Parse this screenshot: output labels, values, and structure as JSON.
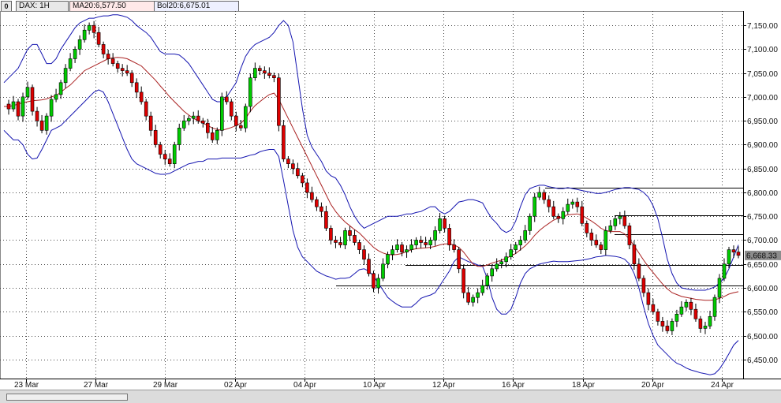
{
  "toolbar": {
    "symbol": "DAX: 1H",
    "ma_label": "MA20:6,577.50",
    "bol_label": "Bol20:6,675.01"
  },
  "colors": {
    "up": "#00cc00",
    "down": "#dd0000",
    "ma": "#aa2222",
    "bands": "#1515b0",
    "grid": "#444444",
    "hlines": "#000000"
  },
  "chart_data": {
    "type": "candlestick",
    "title": "DAX: 1H",
    "ylim": [
      6410,
      7180
    ],
    "y_ticks": [
      "7,150.00",
      "7,100.00",
      "7,050.00",
      "7,000.00",
      "6,950.00",
      "6,900.00",
      "6,850.00",
      "6,800.00",
      "6,750.00",
      "6,700.00",
      "6,650.00",
      "6,600.00",
      "6,550.00",
      "6,500.00",
      "6,450.00"
    ],
    "y_tick_values": [
      7150,
      7100,
      7050,
      7000,
      6950,
      6900,
      6850,
      6800,
      6750,
      6700,
      6650,
      6600,
      6550,
      6500,
      6450
    ],
    "x_labels": [
      "23 Mar",
      "27 Mar",
      "29 Mar",
      "02 Apr",
      "04 Apr",
      "10 Apr",
      "12 Apr",
      "16 Apr",
      "18 Apr",
      "20 Apr",
      "24 Apr"
    ],
    "last_price": "6,668.33",
    "grid": true,
    "horizontal_lines": [
      {
        "from": "18 Apr",
        "y": 6810
      },
      {
        "from": "20 Apr",
        "y": 6752
      },
      {
        "from": "20 Apr",
        "y": 6713
      },
      {
        "from": "12 Apr",
        "y": 6648
      },
      {
        "from": "10 Apr",
        "y": 6605
      }
    ],
    "close_path": [
      6985,
      6975,
      6990,
      6960,
      7000,
      7020,
      6970,
      6950,
      6930,
      6960,
      6995,
      7005,
      7030,
      7060,
      7080,
      7100,
      7120,
      7140,
      7150,
      7135,
      7110,
      7090,
      7080,
      7070,
      7060,
      7055,
      7050,
      7030,
      7010,
      6990,
      6960,
      6930,
      6900,
      6880,
      6870,
      6860,
      6900,
      6935,
      6950,
      6955,
      6960,
      6950,
      6945,
      6925,
      6910,
      6930,
      7000,
      6990,
      6960,
      6940,
      6935,
      6980,
      7040,
      7060,
      7055,
      7050,
      7045,
      7040,
      6940,
      6870,
      6860,
      6850,
      6835,
      6820,
      6800,
      6785,
      6770,
      6760,
      6725,
      6700,
      6695,
      6690,
      6720,
      6710,
      6695,
      6680,
      6660,
      6630,
      6600,
      6620,
      6650,
      6670,
      6680,
      6690,
      6675,
      6680,
      6690,
      6700,
      6695,
      6690,
      6700,
      6720,
      6745,
      6725,
      6690,
      6680,
      6640,
      6590,
      6570,
      6580,
      6590,
      6605,
      6625,
      6640,
      6650,
      6655,
      6665,
      6680,
      6690,
      6700,
      6720,
      6750,
      6790,
      6800,
      6785,
      6770,
      6750,
      6745,
      6760,
      6775,
      6780,
      6770,
      6735,
      6715,
      6700,
      6690,
      6680,
      6720,
      6730,
      6745,
      6750,
      6730,
      6690,
      6650,
      6620,
      6590,
      6565,
      6550,
      6530,
      6520,
      6510,
      6530,
      6545,
      6560,
      6570,
      6555,
      6535,
      6515,
      6520,
      6540,
      6580,
      6620,
      6650,
      6680,
      6675,
      6668
    ],
    "ma20": [
      6980,
      6980,
      6982,
      6985,
      6988,
      6990,
      6992,
      6993,
      6994,
      6996,
      7000,
      7003,
      7010,
      7018,
      7025,
      7035,
      7045,
      7055,
      7060,
      7065,
      7070,
      7075,
      7080,
      7082,
      7083,
      7082,
      7080,
      7075,
      7070,
      7065,
      7055,
      7045,
      7035,
      7023,
      7012,
      7000,
      6990,
      6980,
      6970,
      6962,
      6955,
      6950,
      6945,
      6940,
      6935,
      6932,
      6930,
      6933,
      6936,
      6940,
      6945,
      6955,
      6970,
      6982,
      6990,
      6998,
      7005,
      7008,
      6995,
      6975,
      6955,
      6935,
      6915,
      6895,
      6875,
      6855,
      6835,
      6815,
      6795,
      6775,
      6760,
      6748,
      6738,
      6730,
      6722,
      6715,
      6705,
      6695,
      6685,
      6678,
      6673,
      6670,
      6669,
      6670,
      6672,
      6676,
      6680,
      6682,
      6683,
      6684,
      6685,
      6687,
      6690,
      6692,
      6692,
      6690,
      6685,
      6675,
      6662,
      6650,
      6645,
      6645,
      6648,
      6652,
      6655,
      6658,
      6662,
      6667,
      6672,
      6680,
      6688,
      6698,
      6710,
      6720,
      6728,
      6735,
      6742,
      6746,
      6750,
      6753,
      6754,
      6755,
      6752,
      6746,
      6740,
      6733,
      6725,
      6720,
      6718,
      6718,
      6718,
      6713,
      6702,
      6688,
      6673,
      6658,
      6644,
      6632,
      6620,
      6608,
      6598,
      6590,
      6586,
      6582,
      6580,
      6578,
      6576,
      6575,
      6574,
      6574,
      6575,
      6578,
      6582,
      6587,
      6590,
      6592
    ],
    "upper_band": [
      7030,
      7040,
      7050,
      7060,
      7080,
      7100,
      7110,
      7110,
      7090,
      7070,
      7070,
      7080,
      7100,
      7115,
      7130,
      7145,
      7155,
      7160,
      7165,
      7165,
      7168,
      7170,
      7170,
      7172,
      7172,
      7170,
      7167,
      7160,
      7150,
      7142,
      7135,
      7125,
      7110,
      7095,
      7090,
      7090,
      7090,
      7088,
      7080,
      7070,
      7055,
      7040,
      7025,
      7010,
      6995,
      6990,
      6990,
      7000,
      7015,
      7030,
      7060,
      7085,
      7100,
      7110,
      7115,
      7120,
      7125,
      7135,
      7150,
      7160,
      7150,
      7115,
      7045,
      6975,
      6920,
      6895,
      6880,
      6865,
      6845,
      6835,
      6830,
      6815,
      6795,
      6770,
      6750,
      6735,
      6725,
      6730,
      6735,
      6740,
      6745,
      6750,
      6750,
      6750,
      6752,
      6755,
      6755,
      6758,
      6760,
      6765,
      6770,
      6770,
      6760,
      6755,
      6760,
      6770,
      6780,
      6782,
      6785,
      6785,
      6782,
      6778,
      6760,
      6745,
      6735,
      6722,
      6716,
      6721,
      6740,
      6770,
      6795,
      6808,
      6812,
      6815,
      6815,
      6812,
      6810,
      6808,
      6808,
      6810,
      6808,
      6806,
      6804,
      6802,
      6800,
      6798,
      6798,
      6800,
      6803,
      6806,
      6808,
      6810,
      6810,
      6808,
      6806,
      6800,
      6790,
      6772,
      6745,
      6705,
      6660,
      6630,
      6610,
      6600,
      6598,
      6596,
      6595,
      6595,
      6595,
      6598,
      6602,
      6610,
      6620,
      6640,
      6665,
      6690
    ],
    "lower_band": [
      6930,
      6920,
      6910,
      6910,
      6900,
      6880,
      6870,
      6872,
      6890,
      6910,
      6930,
      6935,
      6940,
      6950,
      6960,
      6970,
      6980,
      6990,
      7000,
      7010,
      7015,
      7010,
      6990,
      6965,
      6940,
      6915,
      6890,
      6870,
      6860,
      6855,
      6850,
      6845,
      6840,
      6838,
      6838,
      6840,
      6845,
      6850,
      6855,
      6860,
      6862,
      6865,
      6865,
      6870,
      6870,
      6870,
      6872,
      6872,
      6872,
      6872,
      6872,
      6875,
      6878,
      6880,
      6885,
      6888,
      6890,
      6890,
      6875,
      6825,
      6772,
      6720,
      6685,
      6665,
      6655,
      6645,
      6635,
      6630,
      6625,
      6622,
      6618,
      6620,
      6620,
      6622,
      6630,
      6638,
      6640,
      6635,
      6625,
      6610,
      6595,
      6580,
      6572,
      6565,
      6560,
      6560,
      6560,
      6568,
      6578,
      6582,
      6585,
      6590,
      6605,
      6620,
      6635,
      6655,
      6665,
      6660,
      6655,
      6652,
      6648,
      6645,
      6620,
      6580,
      6555,
      6545,
      6545,
      6555,
      6580,
      6610,
      6630,
      6640,
      6645,
      6650,
      6652,
      6654,
      6656,
      6655,
      6655,
      6655,
      6656,
      6657,
      6658,
      6660,
      6662,
      6665,
      6666,
      6668,
      6667,
      6666,
      6664,
      6660,
      6650,
      6630,
      6600,
      6560,
      6525,
      6500,
      6480,
      6470,
      6460,
      6450,
      6442,
      6438,
      6432,
      6428,
      6425,
      6422,
      6420,
      6418,
      6420,
      6430,
      6445,
      6462,
      6480,
      6490
    ]
  }
}
